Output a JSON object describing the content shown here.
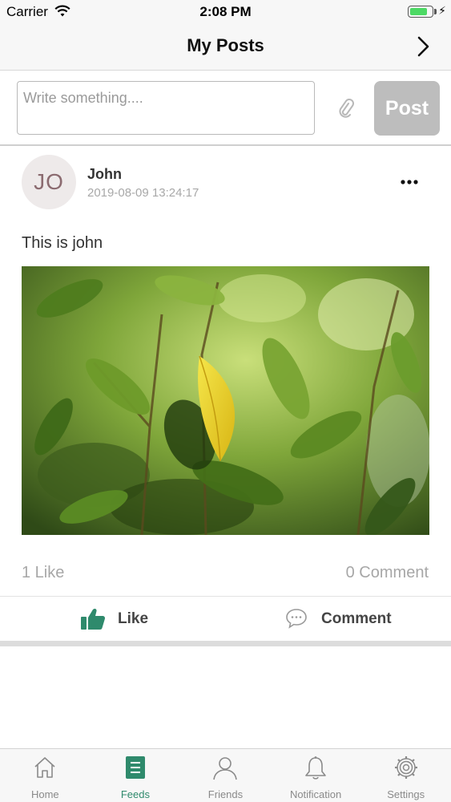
{
  "status_bar": {
    "carrier": "Carrier",
    "time": "2:08 PM",
    "battery_level": 0.7
  },
  "nav": {
    "title": "My Posts",
    "right_icon": "chevron-right-icon"
  },
  "composer": {
    "placeholder": "Write something....",
    "value": "",
    "attach_icon": "paperclip-icon",
    "post_label": "Post"
  },
  "post": {
    "avatar_initials": "JO",
    "author": "John",
    "timestamp": "2019-08-09 13:24:17",
    "more_icon": "more-horizontal-icon",
    "text": "This is john",
    "image_description_icon": "photo",
    "like_count": "1 Like",
    "comment_count": "0 Comment",
    "like_label": "Like",
    "comment_label": "Comment"
  },
  "tabs": [
    {
      "label": "Home",
      "icon": "home-icon",
      "active": false
    },
    {
      "label": "Feeds",
      "icon": "feeds-icon",
      "active": true
    },
    {
      "label": "Friends",
      "icon": "friends-icon",
      "active": false
    },
    {
      "label": "Notification",
      "icon": "bell-icon",
      "active": false
    },
    {
      "label": "Settings",
      "icon": "gear-icon",
      "active": false
    }
  ],
  "colors": {
    "accent": "#2f8a6c",
    "post_button_disabled": "#bdbdbd",
    "muted_text": "#a7a7a7"
  }
}
